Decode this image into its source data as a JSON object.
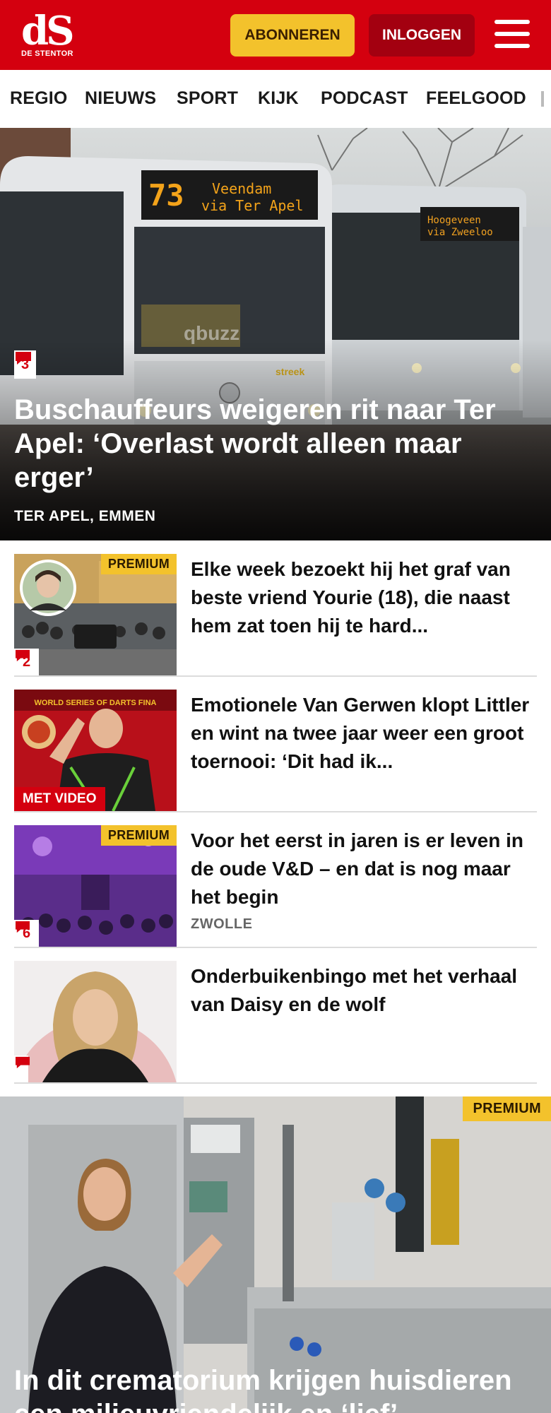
{
  "header": {
    "logo_text": "dS",
    "logo_sub": "DE STENTOR",
    "subscribe_label": "ABONNEREN",
    "login_label": "INLOGGEN",
    "menu_icon": "hamburger-menu-icon",
    "brand_color": "#d4000f"
  },
  "nav": {
    "items": [
      "REGIO",
      "NIEUWS",
      "SPORT",
      "KIJK",
      "PODCAST",
      "FEELGOOD"
    ]
  },
  "hero": {
    "comments": "3",
    "title": "Buschauffeurs weigeren rit naar Ter Apel: ‘Overlast wordt alleen maar erger’",
    "location": "TER APEL, EMMEN",
    "bus_route": "73",
    "bus_dest_1": "Veendam",
    "bus_dest_2": "via Ter Apel",
    "bus_brand": "qbuzz",
    "bus_sub": "streek"
  },
  "articles": [
    {
      "title": "Elke week bezoekt hij het graf van beste vriend Yourie (18), die naast hem zat toen hij te hard...",
      "premium": "PREMIUM",
      "comments": "2"
    },
    {
      "title": "Emotionele Van Gerwen klopt Littler en wint na twee jaar weer een groot toernooi: ‘Dit had ik...",
      "video": "MET VIDEO",
      "banner_text": "WORLD SERIES OF DARTS FINA"
    },
    {
      "title": "Voor het eerst in jaren is er leven in de oude V&D – en dat is nog maar het begin",
      "premium": "PREMIUM",
      "comments": "6",
      "location": "ZWOLLE"
    },
    {
      "title": "Onderbuikenbingo met het verhaal van Daisy en de wolf"
    }
  ],
  "big_article": {
    "premium": "PREMIUM",
    "title": "In dit crematorium krijgen huisdieren een milieuvriendelijk en ‘lief’"
  }
}
